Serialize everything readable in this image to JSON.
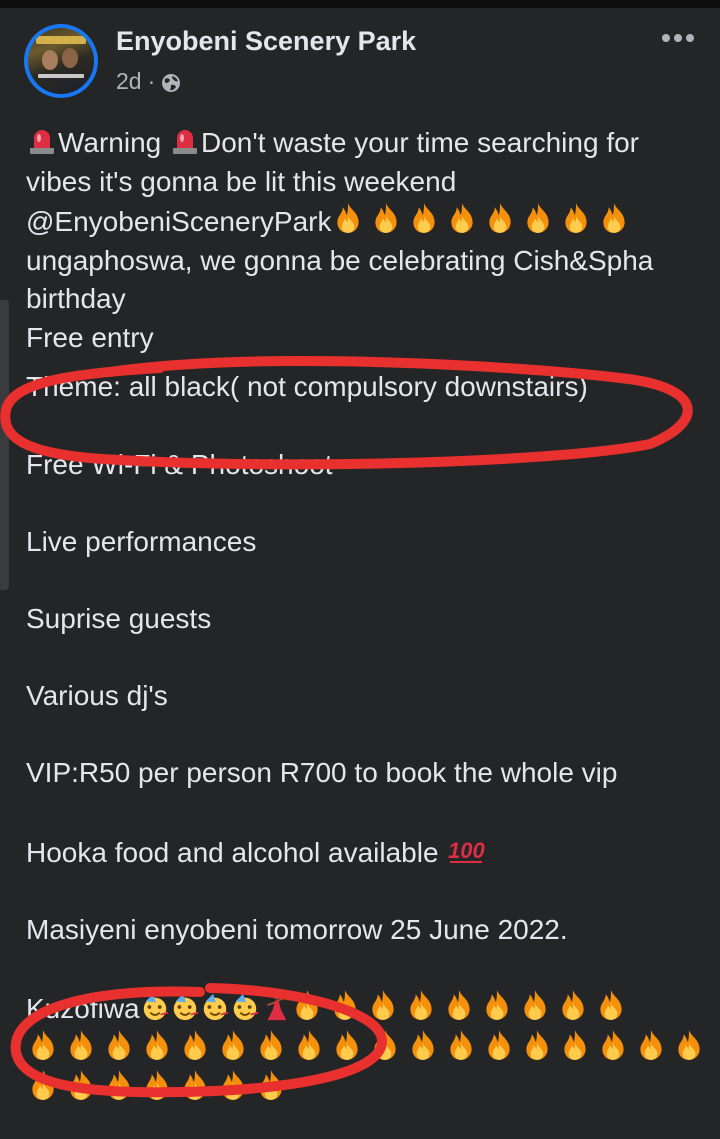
{
  "post": {
    "page_name": "Enyobeni Scenery Park",
    "time": "2d",
    "separator": "·",
    "lines": {
      "warning_word": "Warning",
      "warning_rest": "Don't waste your time searching for",
      "l2": "vibes it's gonna be lit this weekend",
      "l3": "@EnyobeniSceneryPark",
      "l4": "ungaphoswa, we gonna be celebrating Cish&Spha",
      "l5": "birthday",
      "l6": "Free entry",
      "l7": "Theme: all black( not compulsory downstairs)",
      "l8": "Free Wi-Fi & Photoshoot",
      "l9": "Live performances",
      "l10": "Suprise guests",
      "l11": "Various dj's",
      "l12": "VIP:R50 per person R700 to book the whole vip",
      "l13": "Hooka food and alcohol available",
      "l14": "Masiyeni enyobeni tomorrow 25  June 2022.",
      "l15": "Kuzofiwa"
    },
    "emoji_icons": [
      "rotating-light-icon",
      "fire-icon",
      "hundred-points-icon",
      "partying-face-icon",
      "dancer-icon"
    ],
    "colors": {
      "background": "#242526",
      "text": "#e4e6eb",
      "secondary_text": "#b0b3b8",
      "highlight_circle": "#e8312e",
      "avatar_ring": "#1877f2"
    }
  }
}
